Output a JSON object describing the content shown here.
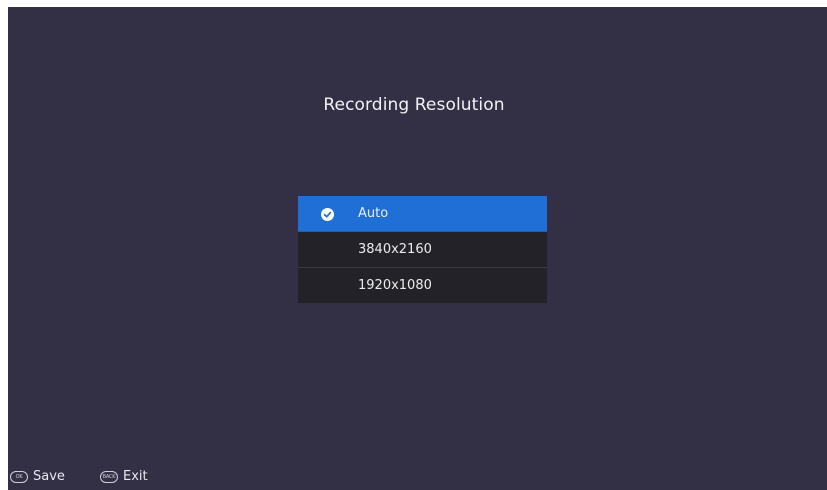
{
  "screen": {
    "title": "Recording Resolution"
  },
  "options": [
    {
      "label": "Auto",
      "selected": true
    },
    {
      "label": "3840x2160",
      "selected": false
    },
    {
      "label": "1920x1080",
      "selected": false
    }
  ],
  "footer": {
    "save_key": "OK",
    "save_label": "Save",
    "exit_key": "BACK",
    "exit_label": "Exit"
  },
  "icons": {
    "selected": "check-circle-icon",
    "ok_key": "ok-key-icon",
    "back_key": "back-key-icon"
  },
  "colors": {
    "background": "#332f45",
    "option_bg": "#232229",
    "selected_bg": "#1f6fd6",
    "text": "#ececf0"
  }
}
